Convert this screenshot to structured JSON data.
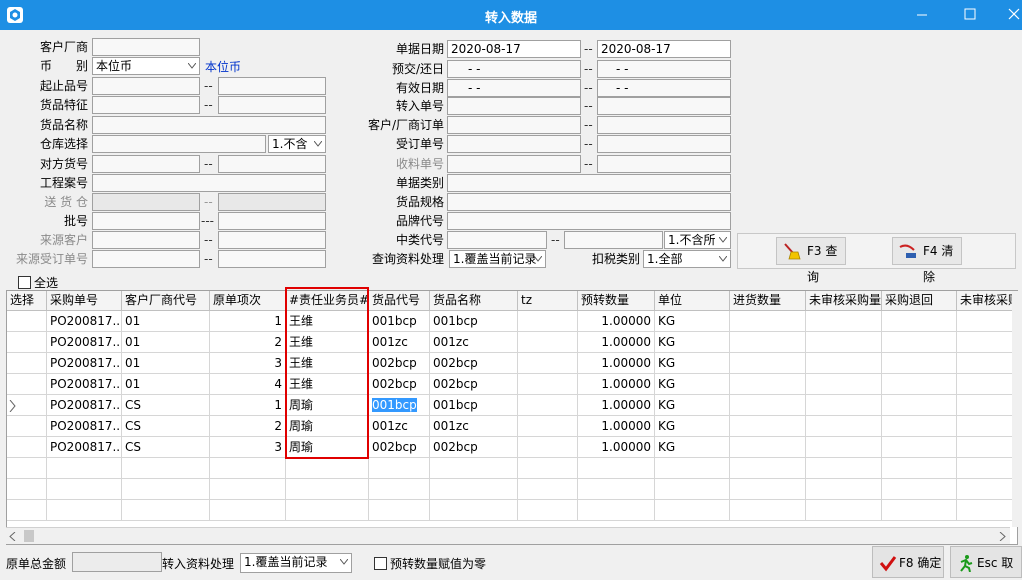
{
  "window": {
    "title": "转入数据"
  },
  "filters": {
    "customer_label": "客户厂商",
    "customer_value": "",
    "currency_label": "币　　别",
    "currency_value": "本位币",
    "currency_link": "本位币",
    "item_range_label": "起止品号",
    "item_from": "",
    "item_to": "",
    "item_feature_label": "货品特征",
    "feature_from": "",
    "feature_to": "",
    "item_name_label": "货品名称",
    "item_name_value": "",
    "warehouse_label": "仓库选择",
    "warehouse_value": "",
    "warehouse_option": "1.不含",
    "counter_item_label": "对方货号",
    "counter_from": "",
    "counter_to": "",
    "project_label": "工程案号",
    "project_value": "",
    "ship_wh_label": "送 货 仓",
    "ship_wh_from": "",
    "ship_wh_to": "",
    "lot_label": "批号",
    "lot_from": "",
    "lot_to": "",
    "source_customer_label": "来源客户",
    "src_cust_from": "",
    "src_cust_to": "",
    "source_order_label": "来源受订单号",
    "src_order_from": "",
    "src_order_to": "",
    "doc_date_label": "单据日期",
    "doc_date_from": "2020-08-17",
    "doc_date_to": "2020-08-17",
    "delivery_date_label": "预交/还日",
    "delivery_from": "- -",
    "delivery_to": "- -",
    "valid_date_label": "有效日期",
    "valid_from": "- -",
    "valid_to": "- -",
    "transfer_no_label": "转入单号",
    "transfer_from": "",
    "transfer_to": "",
    "cust_order_label": "客户/厂商订单",
    "cust_order_from": "",
    "cust_order_to": "",
    "sales_order_label": "受订单号",
    "sales_order_from": "",
    "sales_order_to": "",
    "receipt_no_label": "收料单号",
    "receipt_from": "",
    "receipt_to": "",
    "doc_type_label": "单据类别",
    "doc_type_value": "",
    "spec_label": "货品规格",
    "spec_value": "",
    "brand_label": "品牌代号",
    "brand_value": "",
    "mid_class_label": "中类代号",
    "mid_class_from": "",
    "mid_class_to": "",
    "mid_class_option": "1.不含所",
    "query_process_label": "查询资料处理",
    "query_process_value": "1.覆盖当前记录",
    "tax_type_label": "扣税类别",
    "tax_type_value": "1.全部",
    "dash": "--",
    "dash3": "---"
  },
  "buttons": {
    "query": "F3 查询",
    "clear": "F4 清除",
    "confirm": "F8 确定",
    "cancel": "Esc 取消"
  },
  "grid": {
    "select_all": "全选",
    "columns": [
      "选择",
      "采购单号",
      "客户厂商代号",
      "原单项次",
      "#责任业务员#",
      "货品代号",
      "货品名称",
      "tz",
      "预转数量",
      "单位",
      "进货数量",
      "未审核采购量",
      "采购退回",
      "未审核采购"
    ],
    "rows": [
      {
        "order": "PO200817...",
        "vendor": "01",
        "line": "1",
        "staff": "王维",
        "item_code": "001bcp",
        "item_name": "001bcp",
        "tz": "",
        "qty": "1.00000",
        "unit": "KG"
      },
      {
        "order": "PO200817...",
        "vendor": "01",
        "line": "2",
        "staff": "王维",
        "item_code": "001zc",
        "item_name": "001zc",
        "tz": "",
        "qty": "1.00000",
        "unit": "KG"
      },
      {
        "order": "PO200817...",
        "vendor": "01",
        "line": "3",
        "staff": "王维",
        "item_code": "002bcp",
        "item_name": "002bcp",
        "tz": "",
        "qty": "1.00000",
        "unit": "KG"
      },
      {
        "order": "PO200817...",
        "vendor": "01",
        "line": "4",
        "staff": "王维",
        "item_code": "002bcp",
        "item_name": "002bcp",
        "tz": "",
        "qty": "1.00000",
        "unit": "KG"
      },
      {
        "order": "PO200817...",
        "vendor": "CS",
        "line": "1",
        "staff": "周瑜",
        "item_code": "001bcp",
        "item_name": "001bcp",
        "tz": "",
        "qty": "1.00000",
        "unit": "KG"
      },
      {
        "order": "PO200817...",
        "vendor": "CS",
        "line": "2",
        "staff": "周瑜",
        "item_code": "001zc",
        "item_name": "001zc",
        "tz": "",
        "qty": "1.00000",
        "unit": "KG"
      },
      {
        "order": "PO200817...",
        "vendor": "CS",
        "line": "3",
        "staff": "周瑜",
        "item_code": "002bcp",
        "item_name": "002bcp",
        "tz": "",
        "qty": "1.00000",
        "unit": "KG"
      }
    ]
  },
  "footer": {
    "total_label": "原单总金额",
    "total_value": "",
    "process_label": "转入资料处理",
    "process_value": "1.覆盖当前记录",
    "zero_label": "预转数量赋值为零"
  },
  "colors": {
    "titlebar": "#1e8fe4",
    "highlight_box": "#e00000",
    "selection": "#3399ff"
  }
}
